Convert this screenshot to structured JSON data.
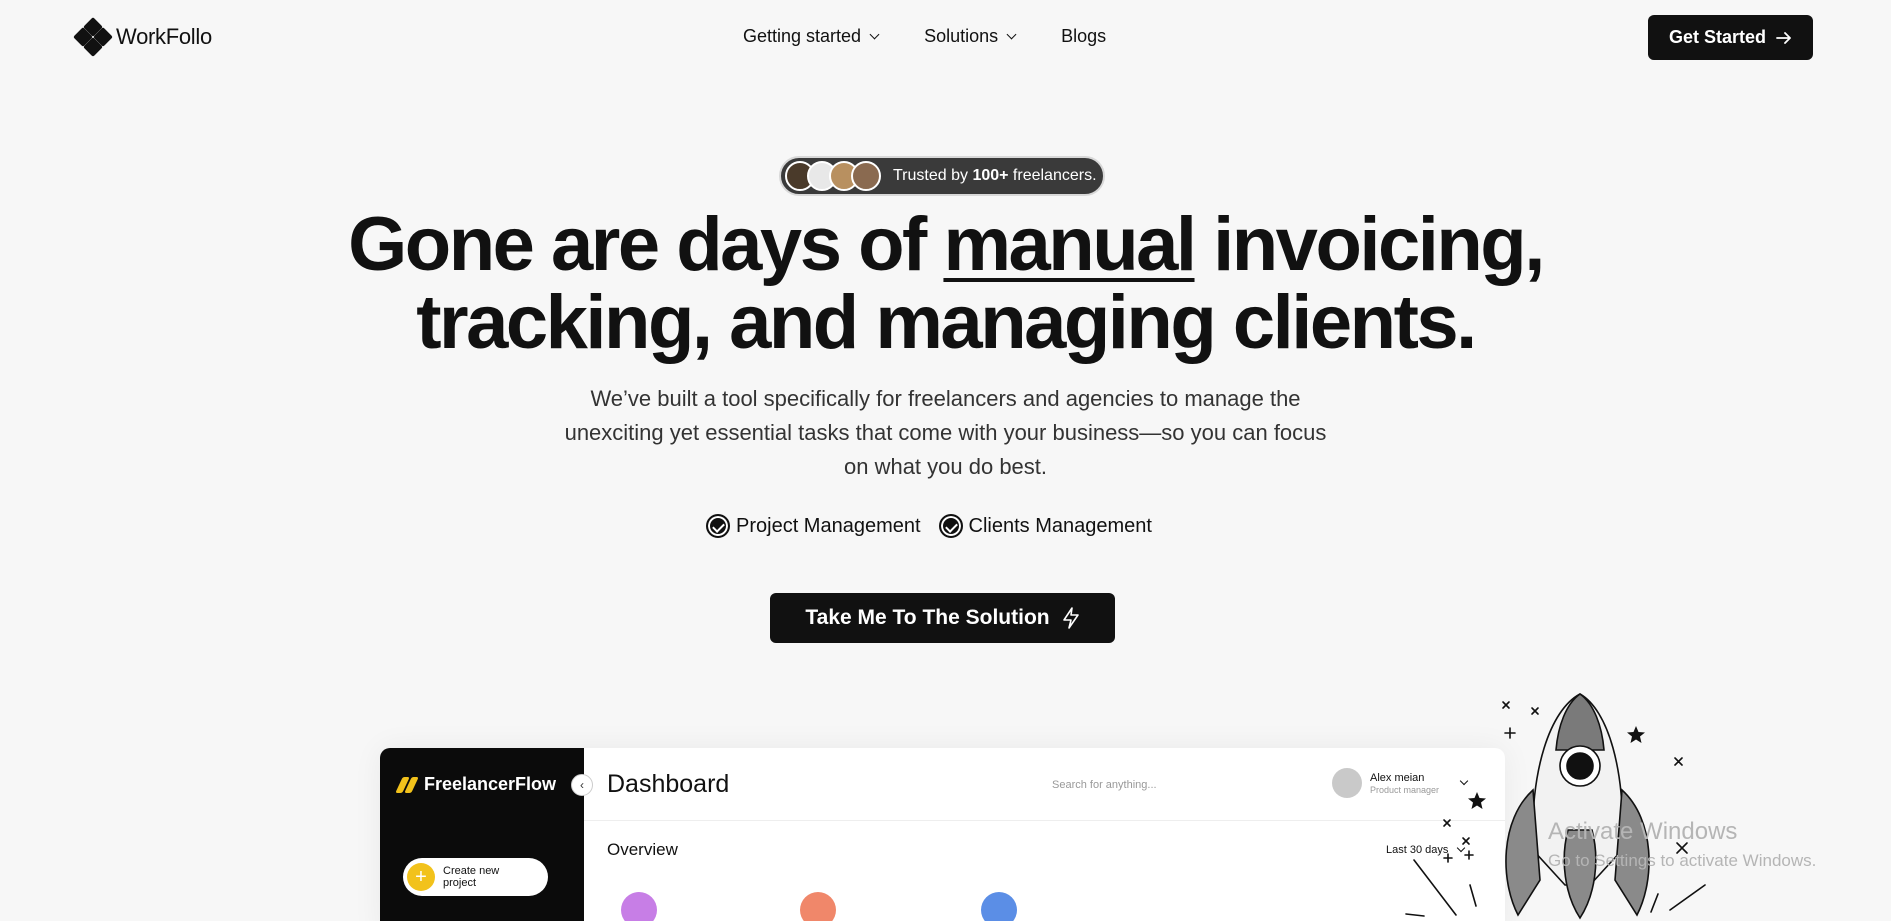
{
  "nav": {
    "brand": "WorkFollo",
    "menu": [
      {
        "label": "Getting started",
        "dropdown": true
      },
      {
        "label": "Solutions",
        "dropdown": true
      },
      {
        "label": "Blogs",
        "dropdown": false
      }
    ],
    "cta_label": "Get Started"
  },
  "trust": {
    "prefix": "Trusted by ",
    "count": "100+",
    "suffix": " freelancers."
  },
  "hero": {
    "line1_pre": "Gone are days of ",
    "line1_underlined": "manual",
    "line1_post": " invoicing,",
    "line2": "tracking, and managing clients.",
    "subtitle": "We’ve built a tool specifically for freelancers and agencies to manage the unexciting yet essential tasks that come with your business—so you can focus on what you do best.",
    "features": [
      "Project Management",
      "Clients Management"
    ],
    "cta_label": "Take Me To The Solution"
  },
  "dashboard": {
    "brand": "FreelancerFlow",
    "create_label": "Create new project",
    "title": "Dashboard",
    "search_placeholder": "Search for anything...",
    "user_name": "Alex meian",
    "user_role": "Product manager",
    "section": "Overview",
    "range": "Last 30 days"
  },
  "watermark": {
    "title": "Activate Windows",
    "subtitle": "Go to Settings to activate Windows."
  },
  "colors": {
    "accent": "#111111",
    "brand_yellow": "#f2c21b",
    "icon_purple": "#c77ee6",
    "icon_orange": "#f0876a",
    "icon_blue": "#5b8ee6"
  }
}
